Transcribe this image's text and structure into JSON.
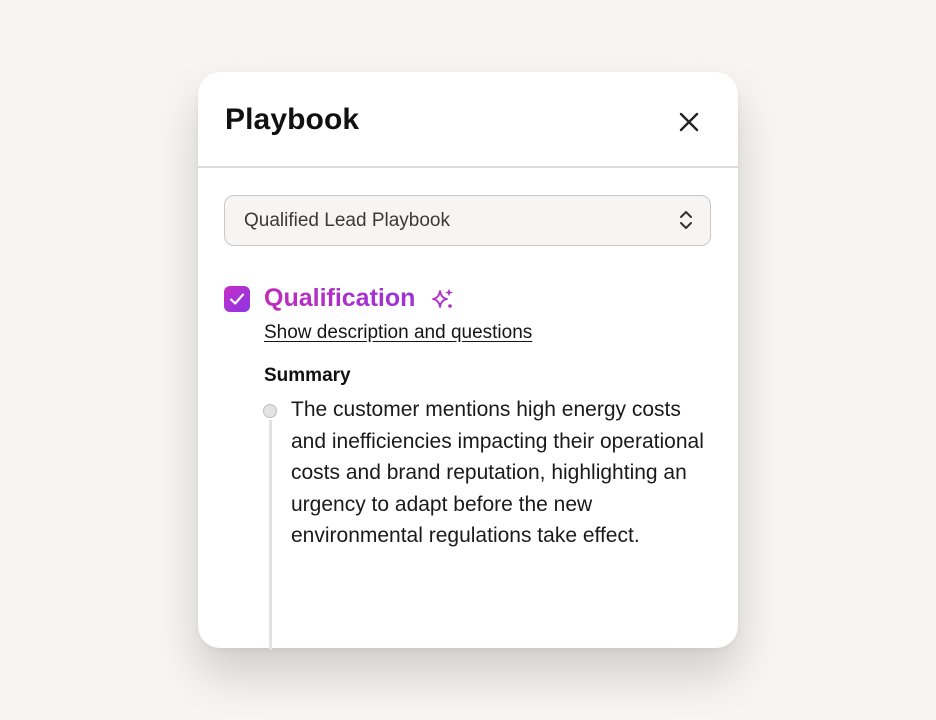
{
  "panel": {
    "title": "Playbook",
    "close_icon": "close-icon"
  },
  "playbook_select": {
    "selected": "Qualified Lead Playbook",
    "icon": "chevron-up-down-icon"
  },
  "section": {
    "checked": true,
    "title": "Qualification",
    "title_icon": "sparkle-icon",
    "link_label": "Show description and questions",
    "summary_heading": "Summary",
    "summary_text": "The customer mentions high energy costs and inefficiencies impacting their operational costs and brand reputation, highlighting an urgency to adapt before the new environmental regulations take effect."
  },
  "colors": {
    "accent_start": "#c42fc4",
    "accent_end": "#8d35e6",
    "background": "#f6f5f3"
  }
}
